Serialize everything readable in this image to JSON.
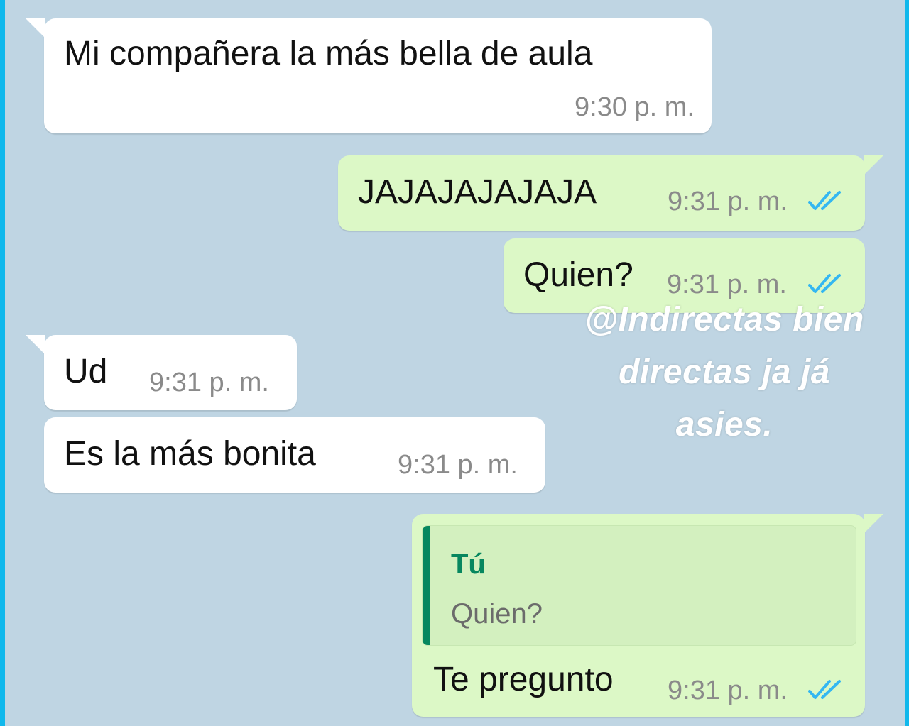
{
  "colors": {
    "chat_background": "#bfd5e3",
    "incoming_bubble": "#ffffff",
    "outgoing_bubble": "#dcf8c6",
    "read_ticks": "#34b7f1",
    "reply_accent": "#07875f",
    "screen_edge": "#10b8ec"
  },
  "messages": [
    {
      "direction": "incoming",
      "text": "Mi compañera la más bella de aula",
      "time": "9:30 p. m."
    },
    {
      "direction": "outgoing",
      "text": "JAJAJAJAJAJA",
      "time": "9:31 p. m.",
      "status_icon": "double-check-read-icon"
    },
    {
      "direction": "outgoing",
      "text": "Quien?",
      "time": "9:31 p. m.",
      "status_icon": "double-check-read-icon"
    },
    {
      "direction": "incoming",
      "text": "Ud",
      "time": "9:31 p. m."
    },
    {
      "direction": "incoming",
      "text": "Es la más bonita",
      "time": "9:31 p. m."
    },
    {
      "direction": "outgoing",
      "reply_to": {
        "author": "Tú",
        "text": "Quien?"
      },
      "text": "Te pregunto",
      "time": "9:31 p. m.",
      "status_icon": "double-check-read-icon"
    }
  ],
  "watermark": {
    "lines": [
      "@Indirectas bien",
      "directas ja já",
      "asies."
    ]
  }
}
